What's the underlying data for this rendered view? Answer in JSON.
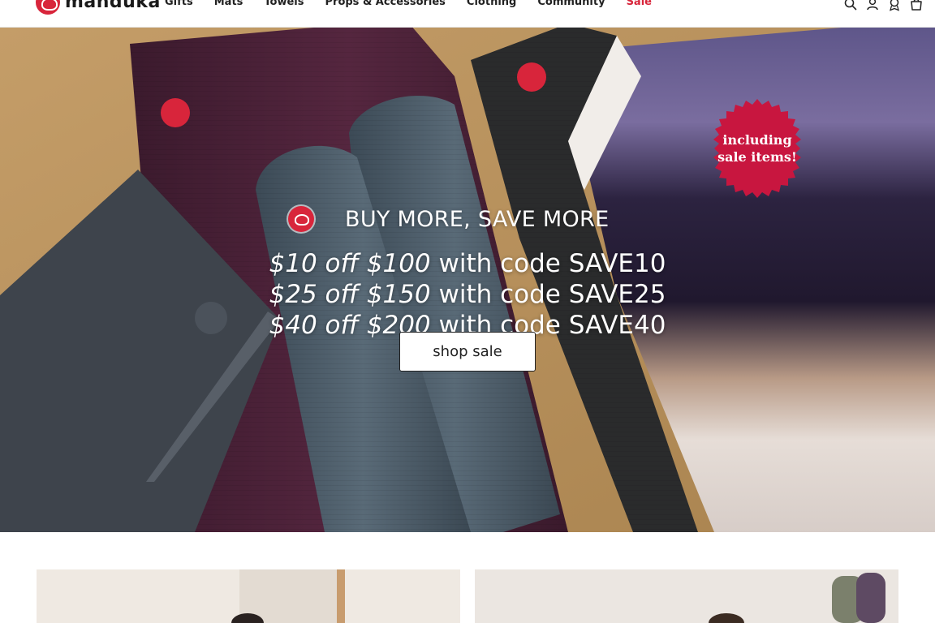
{
  "brand": {
    "name": "manduka"
  },
  "nav": {
    "items": [
      {
        "label": "Gifts"
      },
      {
        "label": "Mats"
      },
      {
        "label": "Towels"
      },
      {
        "label": "Props & Accessories"
      },
      {
        "label": "Clothing"
      },
      {
        "label": "Community"
      },
      {
        "label": "Sale"
      }
    ]
  },
  "utility_icons": [
    "search-icon",
    "account-icon",
    "rewards-icon",
    "cart-icon"
  ],
  "hero": {
    "headline": "BUY MORE, SAVE MORE",
    "offers": [
      {
        "amount": "$10 off $100",
        "text": " with code SAVE10"
      },
      {
        "amount": "$25 off $150",
        "text": " with code SAVE25"
      },
      {
        "amount": "$40 off $200",
        "text": " with code SAVE40"
      }
    ],
    "cta_label": "shop sale",
    "badge_line1": "including",
    "badge_line2": "sale items!"
  },
  "colors": {
    "brand_red": "#d8253b",
    "sale_red": "#d8253b",
    "badge": "#c8163f",
    "text": "#222222"
  }
}
